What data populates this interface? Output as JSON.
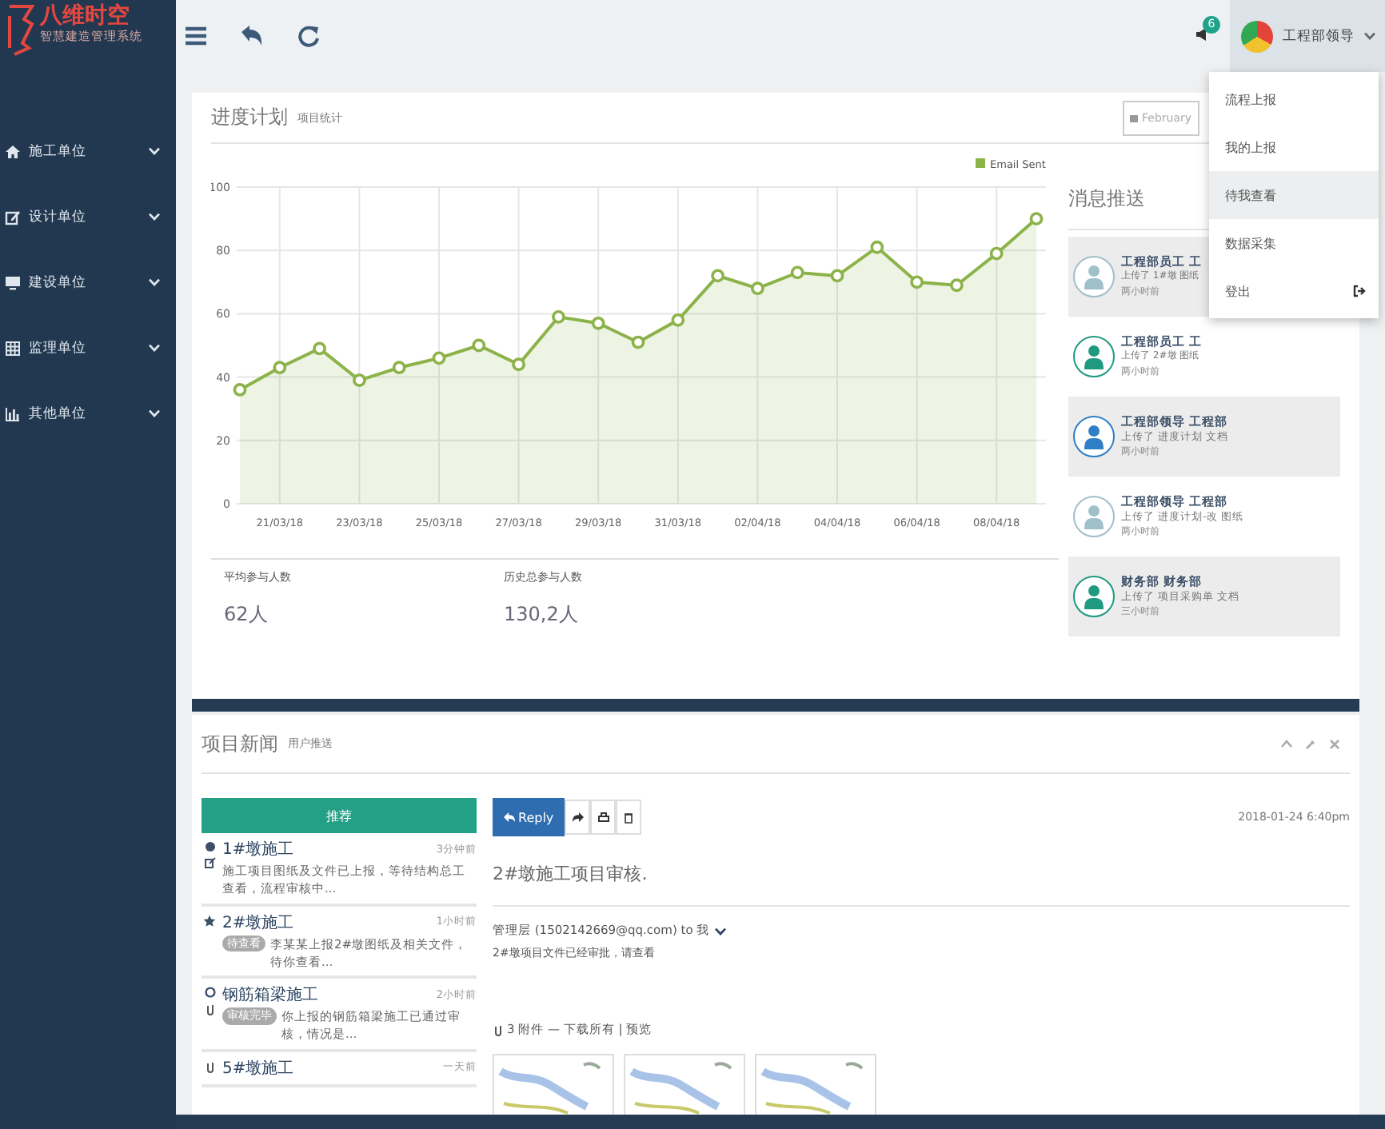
{
  "sidebar": {
    "logo_title": "八维时空",
    "logo_subtitle": "智慧建造管理系统",
    "items": [
      {
        "label": "施工单位",
        "kind": "home"
      },
      {
        "label": "设计单位",
        "kind": "edit"
      },
      {
        "label": "建设单位",
        "kind": "monitor"
      },
      {
        "label": "监理单位",
        "kind": "table"
      },
      {
        "label": "其他单位",
        "kind": "chart"
      }
    ]
  },
  "topbar": {
    "notification_badge": "6",
    "user_name": "工程部领导"
  },
  "user_menu": {
    "items": [
      {
        "label": "流程上报",
        "selected": false,
        "kind": "link"
      },
      {
        "label": "我的上报",
        "selected": false,
        "kind": "link"
      },
      {
        "label": "待我查看",
        "selected": true,
        "kind": "link"
      },
      {
        "label": "数据采集",
        "selected": false,
        "kind": "link"
      },
      {
        "label": "登出",
        "selected": false,
        "kind": "logout"
      }
    ]
  },
  "progress_panel": {
    "title": "进度计划",
    "subtitle": "项目统计",
    "date_field": "February",
    "chart_data": {
      "type": "area",
      "categories": [
        null,
        "21/03/18",
        null,
        "23/03/18",
        null,
        "25/03/18",
        null,
        "27/03/18",
        null,
        "29/03/18",
        null,
        "31/03/18",
        null,
        "02/04/18",
        null,
        "04/04/18",
        null,
        "06/04/18",
        null,
        "08/04/18",
        null
      ],
      "grid": true,
      "series": [
        {
          "name": "Email Sent",
          "color": "#8cb34a",
          "values": [
            36,
            43,
            49,
            39,
            43,
            46,
            50,
            44,
            59,
            57,
            51,
            58,
            72,
            68,
            73,
            72,
            81,
            70,
            69,
            79,
            90
          ],
          "marker": "circle"
        }
      ],
      "ylim": [
        0,
        100
      ],
      "yticks": [
        0,
        20,
        40,
        60,
        80,
        100
      ]
    },
    "stats": [
      {
        "label": "平均参与人数",
        "value": "62人"
      },
      {
        "label": "历史总参与人数",
        "value": "130,2人"
      }
    ]
  },
  "messages": {
    "title": "消息推送",
    "items": [
      {
        "name": "工程部员工 工",
        "action": "上传了 1#墩 图纸",
        "time": "两小时前",
        "color": "#9fc0c9"
      },
      {
        "name": "工程部员工 工",
        "action": "上传了 2#墩 图纸",
        "time": "两小时前",
        "color": "#1f9a80"
      },
      {
        "name": "工程部领导 工程部",
        "action": "上传了 进度计划 文档",
        "time": "两小时前",
        "color": "#2f7fc6"
      },
      {
        "name": "工程部领导 工程部",
        "action": "上传了 进度计划-改 图纸",
        "time": "两小时前",
        "color": "#9fc0c9"
      },
      {
        "name": "财务部 财务部",
        "action": "上传了 项目采购单 文档",
        "time": "三小时前",
        "color": "#1f9a80"
      }
    ]
  },
  "news_panel": {
    "title": "项目新闻",
    "subtitle": "用户推送",
    "recommend_button": "推荐",
    "list": [
      {
        "kind": "new",
        "title": "1#墩施工",
        "time": "3分钟前",
        "text": "施工项目图纸及文件已上报，等待结构总工查看，流程审核中..."
      },
      {
        "kind": "starred",
        "title": "2#墩施工",
        "time": "1小时前",
        "tag": "待查看",
        "text": "李某某上报2#墩图纸及相关文件，待你查看..."
      },
      {
        "kind": "reviewed",
        "title": "钢筋箱梁施工",
        "time": "2小时前",
        "tag": "审核完毕",
        "text": "你上报的钢筋箱梁施工已通过审核，情况是..."
      },
      {
        "kind": "attachment",
        "title": "5#墩施工",
        "time": "一天前"
      }
    ],
    "mail": {
      "reply_button": "Reply",
      "date": "2018-01-24 6:40pm",
      "subject": "2#墩施工项目审核.",
      "from": "管理层 (1502142669@qq.com) to 我",
      "body": "2#墩项目文件已经审批，请查看",
      "attachments": "3 附件 — 下载所有 | 预览"
    }
  }
}
